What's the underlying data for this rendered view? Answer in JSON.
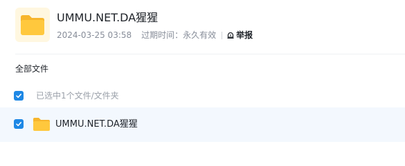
{
  "share": {
    "title": "UMMU.NET.DA猩猩",
    "date": "2024-03-25 03:58",
    "expire": "过期时间：永久有效",
    "report_label": "举报"
  },
  "breadcrumb": "全部文件",
  "selection": {
    "text": "已选中1个文件/文件夹"
  },
  "files": [
    {
      "name": "UMMU.NET.DA猩猩",
      "icon": "folder-icon",
      "checked": true
    }
  ],
  "colors": {
    "accent": "#1e88e5",
    "folder": "#ffc83d",
    "row_selected_bg": "#f3f8fe"
  }
}
